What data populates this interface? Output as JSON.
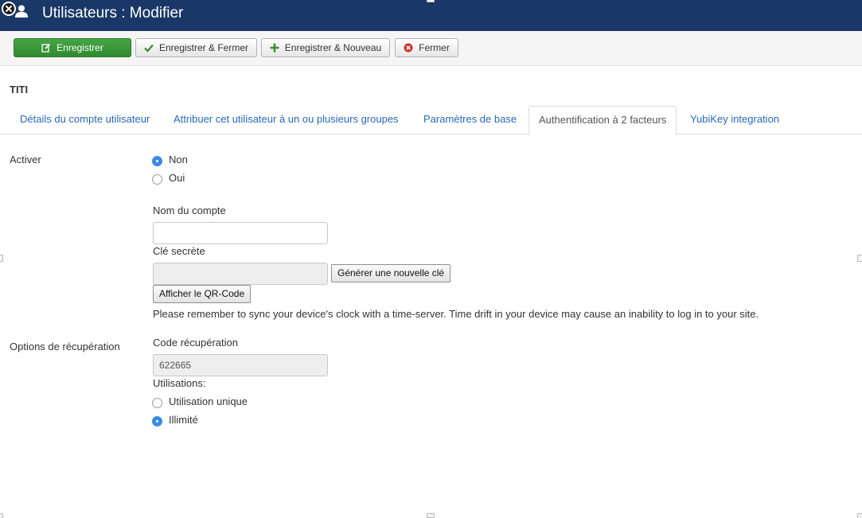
{
  "header": {
    "title": "Utilisateurs : Modifier",
    "close_icon": "close-circle-icon",
    "user_icon": "user-icon"
  },
  "toolbar": {
    "save_label": "Enregistrer",
    "save_close_label": "Enregistrer & Fermer",
    "save_new_label": "Enregistrer & Nouveau",
    "close_label": "Fermer"
  },
  "user": {
    "name": "TITI"
  },
  "tabs": [
    {
      "label": "Détails du compte utilisateur"
    },
    {
      "label": "Attribuer cet utilisateur à un ou plusieurs groupes"
    },
    {
      "label": "Paramètres de base"
    },
    {
      "label": "Authentification à 2 facteurs",
      "active": true
    },
    {
      "label": "YubiKey integration"
    }
  ],
  "activate": {
    "label": "Activer",
    "options": [
      {
        "label": "Non",
        "checked": true
      },
      {
        "label": "Oui",
        "checked": false
      }
    ]
  },
  "account": {
    "name_label": "Nom du compte",
    "name_value": "",
    "secret_label": "Clé secrète",
    "secret_value": "",
    "generate_button": "Générer une nouvelle clé",
    "qr_button": "Afficher le QR-Code",
    "note": "Please remember to sync your device's clock with a time-server. Time drift in your device may cause an inability to log in to your site."
  },
  "recovery": {
    "label": "Options de récupération",
    "code_label": "Code récupération",
    "code_value": "622665",
    "uses_label": "Utilisations:",
    "options": [
      {
        "label": "Utilisation unique",
        "checked": false
      },
      {
        "label": "Illimité",
        "checked": true
      }
    ]
  },
  "colors": {
    "header_bg": "#1a3867",
    "save_green": "#3d9a3d",
    "tab_link": "#2a69b8",
    "radio_checked": "#3b8be9"
  }
}
